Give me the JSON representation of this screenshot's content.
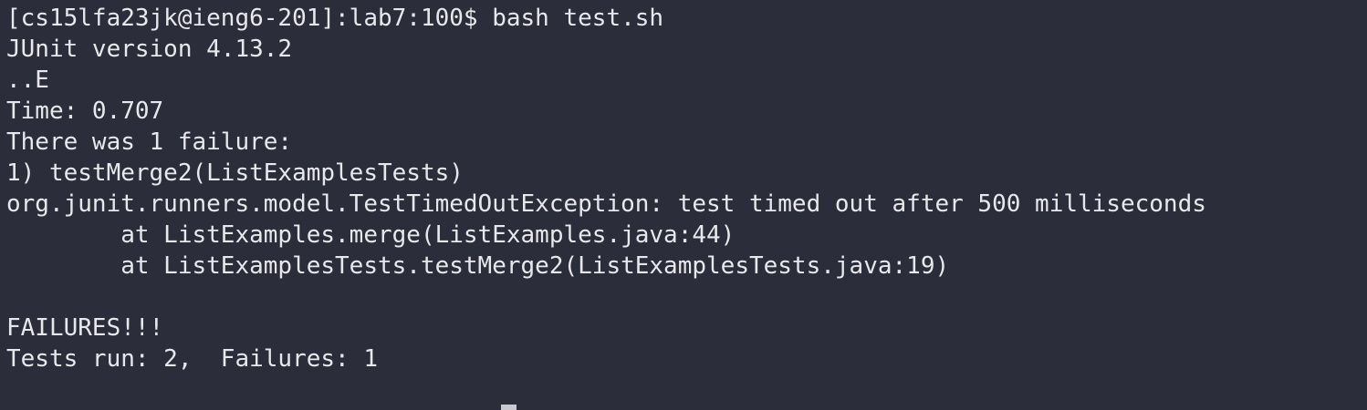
{
  "terminal": {
    "lines": [
      "[cs15lfa23jk@ieng6-201]:lab7:100$ bash test.sh",
      "JUnit version 4.13.2",
      "..E",
      "Time: 0.707",
      "There was 1 failure:",
      "1) testMerge2(ListExamplesTests)",
      "org.junit.runners.model.TestTimedOutException: test timed out after 500 milliseconds",
      "        at ListExamples.merge(ListExamples.java:44)",
      "        at ListExamplesTests.testMerge2(ListExamplesTests.java:19)",
      "",
      "FAILURES!!!",
      "Tests run: 2,  Failures: 1",
      ""
    ]
  },
  "colors": {
    "background": "#2b2d3a",
    "foreground": "#e8e8ec",
    "cursor": "#c9c9cf"
  }
}
